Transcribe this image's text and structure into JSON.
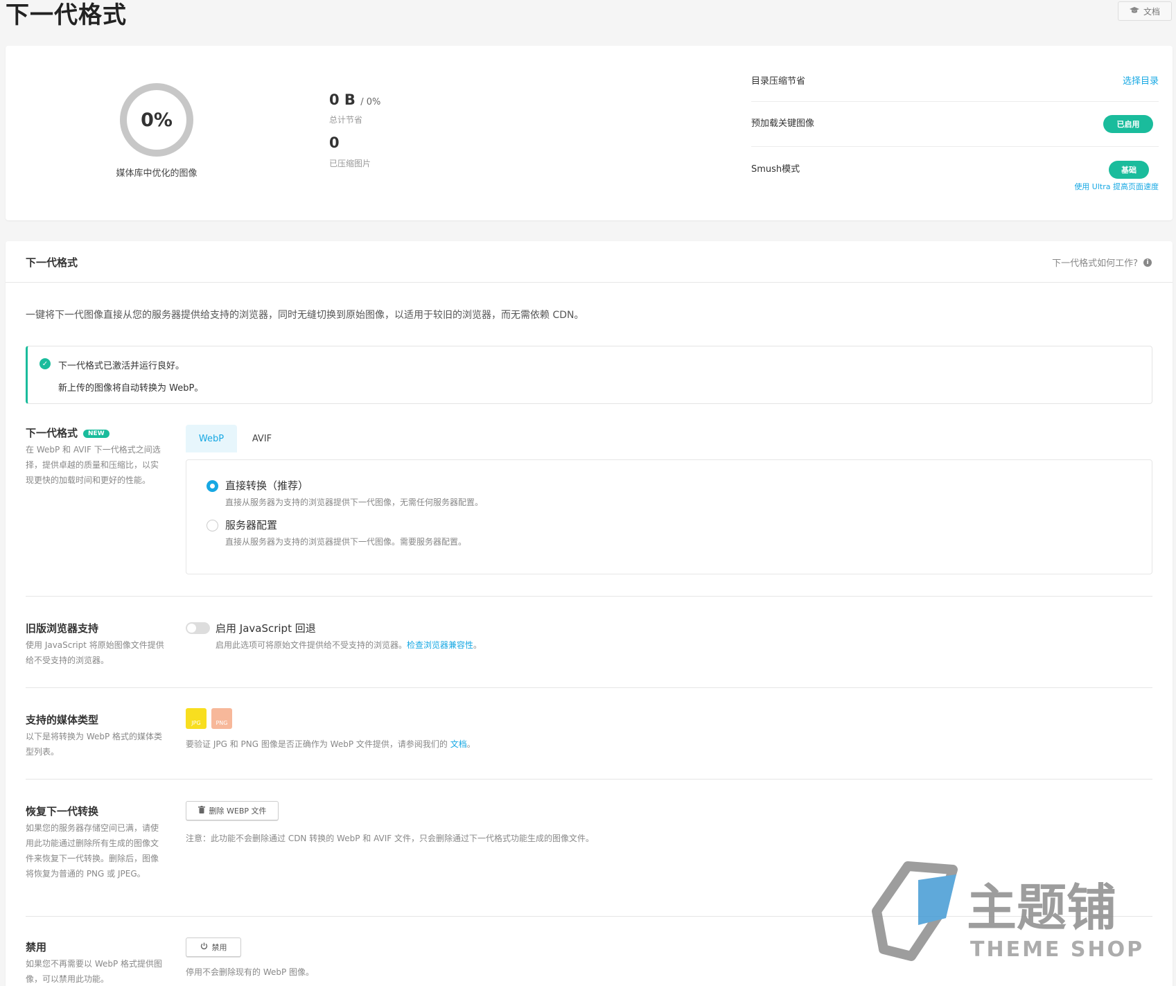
{
  "header": {
    "title": "下一代格式",
    "docs_label": "文档"
  },
  "summary": {
    "percent": "0%",
    "ring_caption": "媒体库中优化的图像",
    "savings_value": "0 B",
    "savings_sub": "/ 0%",
    "savings_label": "总计节省",
    "compressed_value": "0",
    "compressed_label": "已压缩图片",
    "dir_label": "目录压缩节省",
    "dir_link": "选择目录",
    "preload_label": "预加载关键图像",
    "preload_status": "已启用",
    "mode_label": "Smush模式",
    "mode_value": "基础",
    "ultra_link": "使用 Ultra 提高页面速度"
  },
  "panel": {
    "title": "下一代格式",
    "help": "下一代格式如何工作?",
    "intro": "一键将下一代图像直接从您的服务器提供给支持的浏览器，同时无缝切换到原始图像，以适用于较旧的浏览器，而无需依赖 CDN。",
    "notice_line1": "下一代格式已激活并运行良好。",
    "notice_line2": "新上传的图像将自动转换为 WebP。"
  },
  "formats": {
    "title": "下一代格式",
    "badge": "NEW",
    "desc": "在 WebP 和 AVIF 下一代格式之间选择，提供卓越的质量和压缩比，以实现更快的加载时间和更好的性能。",
    "tabs": [
      "WebP",
      "AVIF"
    ],
    "options": [
      {
        "label": "直接转换（推荐）",
        "desc": "直接从服务器为支持的浏览器提供下一代图像，无需任何服务器配置。",
        "selected": true
      },
      {
        "label": "服务器配置",
        "desc": "直接从服务器为支持的浏览器提供下一代图像。需要服务器配置。",
        "selected": false
      }
    ]
  },
  "legacy": {
    "title": "旧版浏览器支持",
    "desc": "使用 JavaScript 将原始图像文件提供给不受支持的浏览器。",
    "toggle_label": "启用 JavaScript 回退",
    "toggle_on": false,
    "toggle_desc": "启用此选项可将原始文件提供给不受支持的浏览器。",
    "toggle_link": "检查浏览器兼容性",
    "toggle_end": "。"
  },
  "media": {
    "title": "支持的媒体类型",
    "desc": "以下是将转换为 WebP 格式的媒体类型列表。",
    "types": [
      "JPG",
      "PNG"
    ],
    "note": "要验证 JPG 和 PNG 图像是否正确作为 WebP 文件提供，请参阅我们的",
    "note_link": "文档",
    "note_end": "。"
  },
  "restore": {
    "title": "恢复下一代转换",
    "desc": "如果您的服务器存储空间已满，请使用此功能通过删除所有生成的图像文件来恢复下一代转换。删除后，图像将恢复为普通的 PNG 或 JPEG。",
    "button": "删除 WEBP 文件",
    "note": "注意：此功能不会删除通过 CDN 转换的 WebP 和 AVIF 文件，只会删除通过下一代格式功能生成的图像文件。"
  },
  "disable": {
    "title": "禁用",
    "desc": "如果您不再需要以 WebP 格式提供图像，可以禁用此功能。",
    "button": "禁用",
    "note": "停用不会删除现有的 WebP 图像。"
  },
  "watermark": {
    "cn": "主题铺",
    "en": "THEME SHOP"
  },
  "colors": {
    "accent": "#17a8e3",
    "success": "#1abc9c",
    "ring": "#c7c7c7"
  }
}
